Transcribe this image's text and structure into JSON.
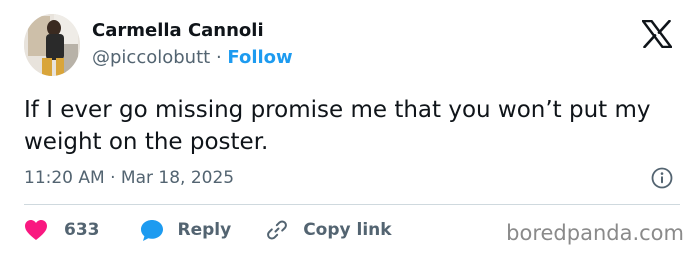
{
  "author": {
    "display_name": "Carmella Cannoli",
    "handle": "@piccolobutt",
    "separator": "·",
    "follow_label": "Follow"
  },
  "tweet": {
    "text": "If I ever go missing promise me that you won’t put my weight on the poster.",
    "timestamp": "11:20 AM · Mar 18, 2025"
  },
  "actions": {
    "like_count": "633",
    "reply_label": "Reply",
    "copy_link_label": "Copy link"
  },
  "icons": {
    "logo": "x-logo-icon",
    "info": "info-icon",
    "like": "heart-icon",
    "reply": "speech-bubble-icon",
    "copy": "link-icon"
  },
  "colors": {
    "accent": "#1d9bf0",
    "like": "#f91880",
    "text": "#0f1419",
    "muted": "#536471"
  },
  "watermark": "boredpanda.com"
}
